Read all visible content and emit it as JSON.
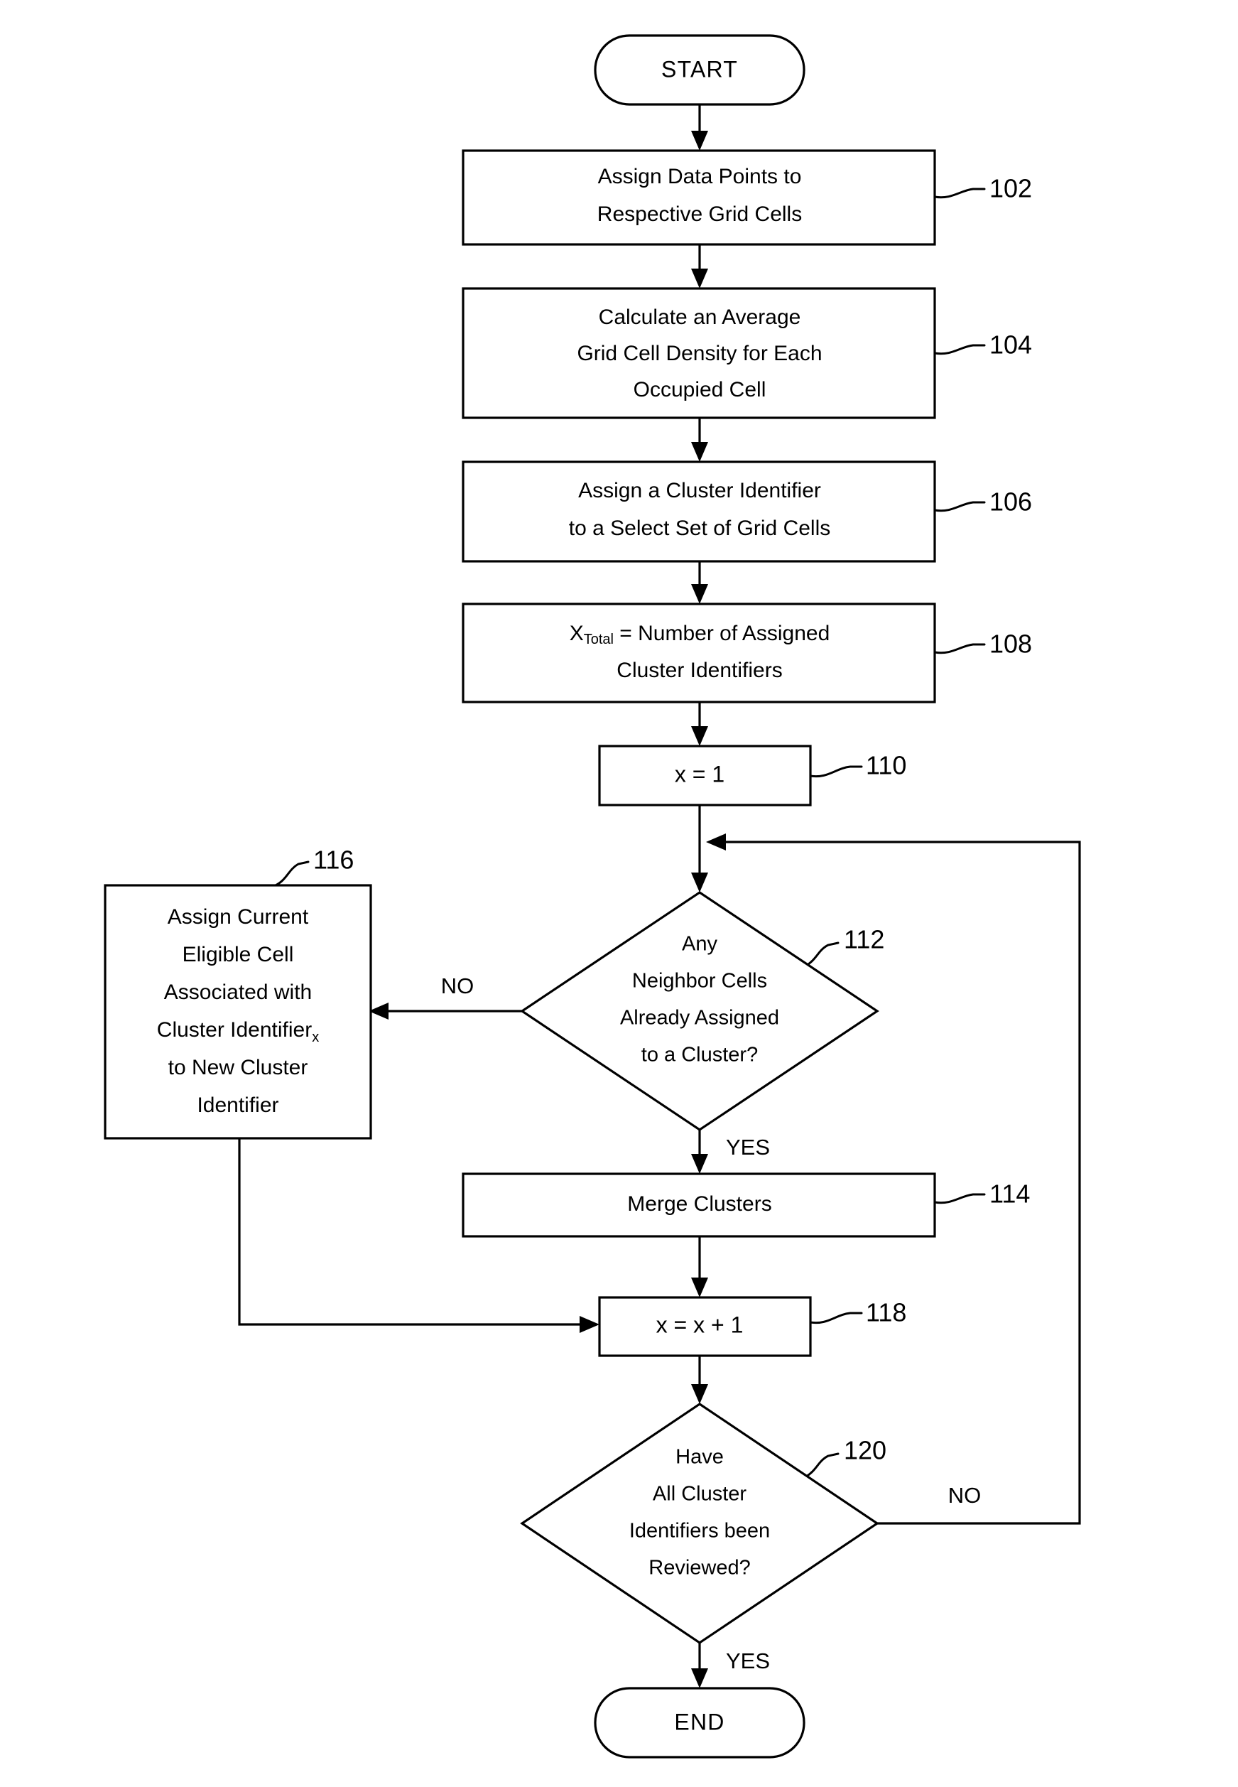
{
  "diagram": {
    "title": "Grid Cell Clustering Process Flowchart",
    "line_color": "#000000",
    "fill_color": "#ffffff",
    "background": "#ffffff"
  },
  "nodes": {
    "start": {
      "type": "terminal",
      "label": "START"
    },
    "n102": {
      "type": "process",
      "ref": "102",
      "lines": [
        "Assign Data Points to",
        "Respective Grid Cells"
      ]
    },
    "n104": {
      "type": "process",
      "ref": "104",
      "lines": [
        "Calculate an Average",
        "Grid Cell Density for Each",
        "Occupied Cell"
      ]
    },
    "n106": {
      "type": "process",
      "ref": "106",
      "lines": [
        "Assign a Cluster Identifier",
        "to a Select Set of Grid Cells"
      ]
    },
    "n108": {
      "type": "process",
      "ref": "108",
      "line1_prefix": "X",
      "line1_subscript": "Total",
      "line1_suffix": " = Number of Assigned",
      "line2": "Cluster Identifiers"
    },
    "n110": {
      "type": "process",
      "ref": "110",
      "label": "x = 1"
    },
    "n112": {
      "type": "decision",
      "ref": "112",
      "lines": [
        "Any",
        "Neighbor Cells",
        "Already Assigned",
        "to a Cluster?"
      ],
      "yes_label": "YES",
      "no_label": "NO"
    },
    "n114": {
      "type": "process",
      "ref": "114",
      "label": "Merge Clusters"
    },
    "n116": {
      "type": "process",
      "ref": "116",
      "lines": [
        "Assign Current",
        "Eligible Cell",
        "Associated with"
      ],
      "line4_prefix": "Cluster Identifier",
      "line4_subscript": "x",
      "lines_tail": [
        "to New Cluster",
        "Identifier"
      ]
    },
    "n118": {
      "type": "process",
      "ref": "118",
      "label": "x = x + 1"
    },
    "n120": {
      "type": "decision",
      "ref": "120",
      "lines": [
        "Have",
        "All Cluster",
        "Identifiers been",
        "Reviewed?"
      ],
      "yes_label": "YES",
      "no_label": "NO"
    },
    "end": {
      "type": "terminal",
      "label": "END"
    }
  },
  "edges": [
    {
      "from": "start",
      "to": "n102",
      "label": ""
    },
    {
      "from": "n102",
      "to": "n104",
      "label": ""
    },
    {
      "from": "n104",
      "to": "n106",
      "label": ""
    },
    {
      "from": "n106",
      "to": "n108",
      "label": ""
    },
    {
      "from": "n108",
      "to": "n110",
      "label": ""
    },
    {
      "from": "n110",
      "to": "n112",
      "label": ""
    },
    {
      "from": "n112",
      "to": "n116",
      "label": "NO"
    },
    {
      "from": "n112",
      "to": "n114",
      "label": "YES"
    },
    {
      "from": "n114",
      "to": "n118",
      "label": ""
    },
    {
      "from": "n116",
      "to": "n118",
      "label": ""
    },
    {
      "from": "n118",
      "to": "n120",
      "label": ""
    },
    {
      "from": "n120",
      "to": "end",
      "label": "YES"
    },
    {
      "from": "n120",
      "to": "n112",
      "label": "NO"
    }
  ]
}
